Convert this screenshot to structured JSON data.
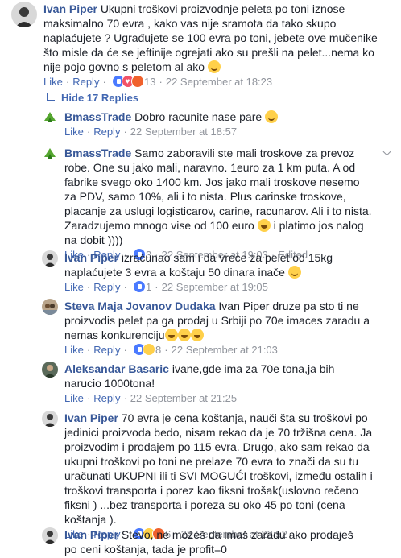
{
  "top_comment": {
    "author": "Ivan Piper",
    "text": "Ukupni troškovi proizvodnje peleta po toni iznose maksimalno 70 evra , kako vas nije sramota da tako skupo naplaćujete ? Ugrađujete se 100 evra po toni, jebete ove mučenike što misle da će se jeftinije ogrejati ako su prešli na pelet...nema ko nije pojo govno s peletom al ako",
    "like": "Like",
    "reply": "Reply",
    "reaction_count": "13",
    "time": "22 September at 18:23",
    "reactions": [
      "like",
      "heart",
      "angry"
    ]
  },
  "hide_replies": "Hide 17 Replies",
  "replies": [
    {
      "author": "BmassTrade",
      "text": "Dobro racunite nase pare",
      "like": "Like",
      "reply": "Reply",
      "time": "22 September at 18:57",
      "emoji": "smile"
    },
    {
      "author": "BmassTrade",
      "text": "Samo zaboravili ste mali troskove za prevoz robe. One su jako mali, naravno. 1euro za 1 km puta. A od fabrike svego oko 1400 km. Jos jako mali troskove nesemo za PDV, samo 10%, ali i to nista. Plus carinske troskove, placanje za uslugi logisticarov, carine, racunarov. Ali i to nista. Zaradzujemo mnogo vise od 100 euro",
      "text_after_emoji": " i platimo jos nalog na dobit ))))",
      "like": "Like",
      "reply": "Reply",
      "reaction_count": "3",
      "time": "22 September at 19:03",
      "edited": "Edited",
      "emoji": "laugh"
    },
    {
      "author": "Ivan Piper",
      "text": "izračunao sam i da vreće za pelet od 15kg naplaćujete 3 evra a koštaju 50 dinara inače",
      "like": "Like",
      "reply": "Reply",
      "reaction_count": "1",
      "time": "22 September at 19:05",
      "emoji": "smile"
    },
    {
      "author": "Steva Maja Jovanov Dudaka",
      "text": "Ivan Piper druze pa sto ti ne proizvodis pelet pa ga prodaj u Srbiji po 70e imaces zaradu a nemas konkurenciju",
      "like": "Like",
      "reply": "Reply",
      "reaction_count": "8",
      "time": "22 September at 21:03",
      "emoji": "laugh"
    },
    {
      "author": "Aleksandar Basaric",
      "text": "ivane,gde ima za 70e tona,ja bih narucio 1000tona!",
      "like": "Like",
      "reply": "Reply",
      "time": "22 September at 21:25"
    },
    {
      "author": "Ivan Piper",
      "text": "70 evra je cena koštanja, nauči šta su troškovi po jedinici proizvoda bedo, nisam rekao da je 70 tržišna cena. Ja proizvodim i prodajem po 115 evra. Drugo, ako sam rekao da ukupni troškovi po toni ne prelaze 70 evra to znači da su tu uračunati UKUPNI ili ti SVI MOGUĆI troškovi, između ostalih i troškovi transporta i porez kao fiksni trošak(uslovno rečeno fiksni ) ...bez transporta i poreza su oko 45 po toni (cena koštanja ).",
      "like": "Like",
      "reply": "Reply",
      "reaction_count": "6",
      "time": "22 September at 23:52"
    },
    {
      "author": "Ivan Piper",
      "text": "Stevo, ne možeš da imaš zaradu ako prodaješ po ceni koštanja, tada je profit=0"
    }
  ]
}
